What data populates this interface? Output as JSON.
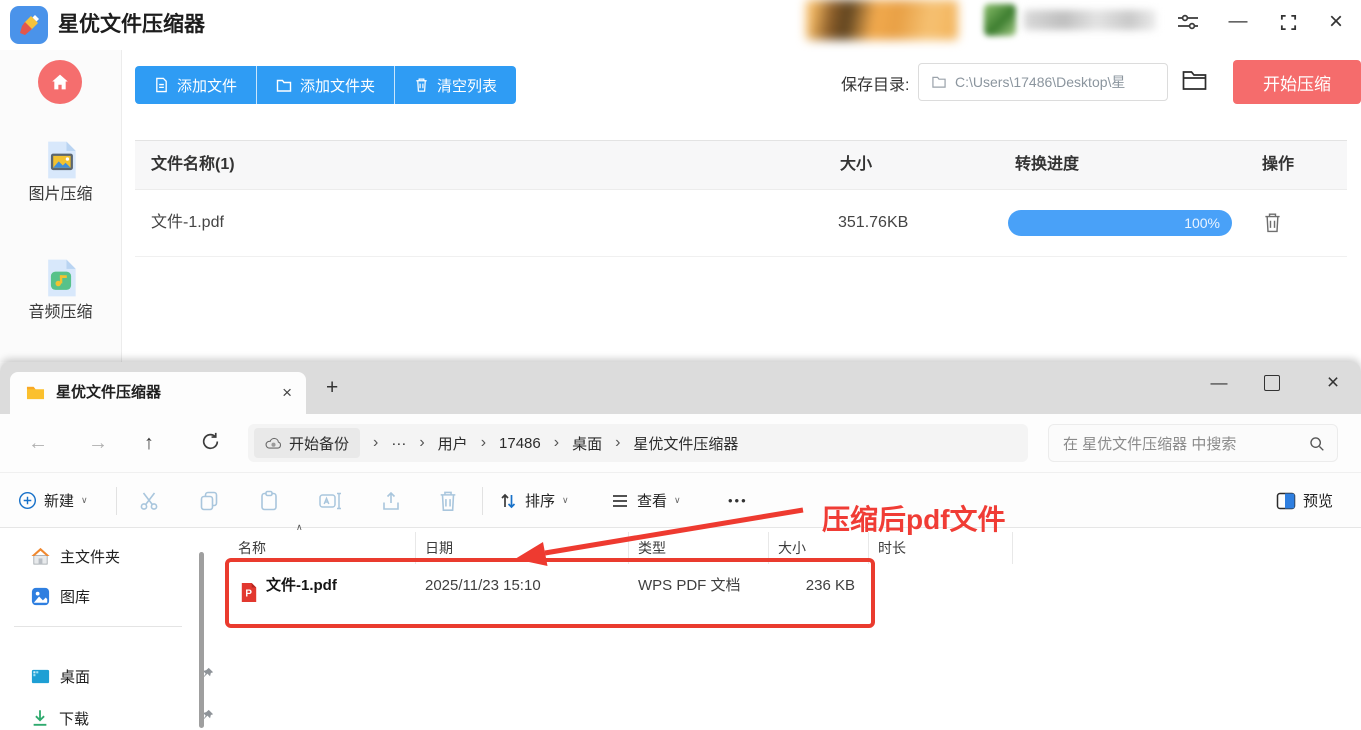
{
  "app": {
    "window_title": "星优文件压缩器",
    "titlebar": {
      "minimize_glyph": "—",
      "close_glyph": "×"
    },
    "sidebar": {
      "image_label": "图片压缩",
      "audio_label": "音频压缩"
    },
    "toolbar": {
      "add_file": "添加文件",
      "add_folder": "添加文件夹",
      "clear_list": "清空列表"
    },
    "save": {
      "label": "保存目录:",
      "path": "C:\\Users\\17486\\Desktop\\星",
      "start": "开始压缩"
    },
    "table": {
      "header_name": "文件名称(1)",
      "header_size": "大小",
      "header_progress": "转换进度",
      "header_action": "操作",
      "row": {
        "name": "文件-1.pdf",
        "size": "351.76KB",
        "progress_pct": "100%"
      }
    }
  },
  "explorer": {
    "tab_title": "星优文件压缩器",
    "glyphs": {
      "close": "×",
      "plus": "+",
      "minimize": "—",
      "back": "←",
      "forward": "→",
      "up": "↑",
      "chevron": "›",
      "ellipsis": "···",
      "caret_down": "∨",
      "caret_up": "∧",
      "more": "•••"
    },
    "breadcrumb": {
      "backup": "开始备份",
      "users": "用户",
      "user_id": "17486",
      "desktop": "桌面",
      "folder": "星优文件压缩器"
    },
    "search_placeholder": "在 星优文件压缩器 中搜索",
    "toolbar": {
      "new": "新建",
      "sort": "排序",
      "view": "查看",
      "preview": "预览"
    },
    "sidebar": {
      "home": "主文件夹",
      "gallery": "图库",
      "desktop": "桌面",
      "downloads": "下载"
    },
    "list": {
      "header_name": "名称",
      "header_date": "日期",
      "header_type": "类型",
      "header_size": "大小",
      "header_duration": "时长",
      "row": {
        "name": "文件-1.pdf",
        "date": "2025/11/23 15:10",
        "type": "WPS PDF 文档",
        "size": "236 KB"
      }
    }
  },
  "annotation": {
    "label": "压缩后pdf文件"
  },
  "colors": {
    "accent_blue": "#2f9cf4",
    "accent_red": "#f56c6c",
    "progress_blue": "#49a1f8",
    "annotation_red": "#ee3a30",
    "win_accent": "#1871c9"
  }
}
